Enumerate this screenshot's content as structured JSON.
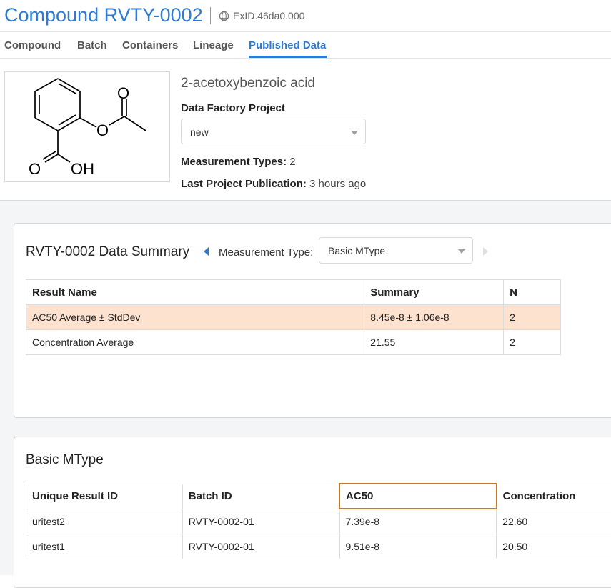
{
  "header": {
    "title": "Compound RVTY-0002",
    "exid": "ExID.46da0.000"
  },
  "tabs": [
    {
      "label": "Compound"
    },
    {
      "label": "Batch"
    },
    {
      "label": "Containers"
    },
    {
      "label": "Lineage"
    },
    {
      "label": "Published Data",
      "active": true
    }
  ],
  "compound": {
    "name": "2-acetoxybenzoic acid",
    "structure_labels": {
      "o_carbonyl": "O",
      "o_ester": "O",
      "o_acid": "O",
      "oh": "OH"
    },
    "project_label": "Data Factory Project",
    "project_value": "new",
    "measurement_types_label": "Measurement Types:",
    "measurement_types_value": "2",
    "last_publication_label": "Last Project Publication:",
    "last_publication_value": "3 hours ago"
  },
  "summary": {
    "title": "RVTY-0002 Data Summary",
    "measurement_type_label": "Measurement Type:",
    "measurement_type_value": "Basic MType",
    "columns": [
      "Result Name",
      "Summary",
      "N"
    ],
    "rows": [
      {
        "result_name": "AC50 Average ± StdDev",
        "summary": "8.45e-8 ± 1.06e-8",
        "n": "2",
        "highlighted": true
      },
      {
        "result_name": "Concentration Average",
        "summary": "21.55",
        "n": "2",
        "highlighted": false
      }
    ]
  },
  "detail": {
    "title": "Basic MType",
    "columns": [
      "Unique Result ID",
      "Batch ID",
      "AC50",
      "Concentration"
    ],
    "rows": [
      {
        "unique_id": "uritest2",
        "batch_id": "RVTY-0002-01",
        "ac50": "7.39e-8",
        "concentration": "22.60"
      },
      {
        "unique_id": "uritest1",
        "batch_id": "RVTY-0002-01",
        "ac50": "9.51e-8",
        "concentration": "20.50"
      }
    ]
  },
  "colors": {
    "accent": "#2d7bd4",
    "highlight_row": "#fde3cf",
    "sorted_column_border": "#c87a2c"
  }
}
